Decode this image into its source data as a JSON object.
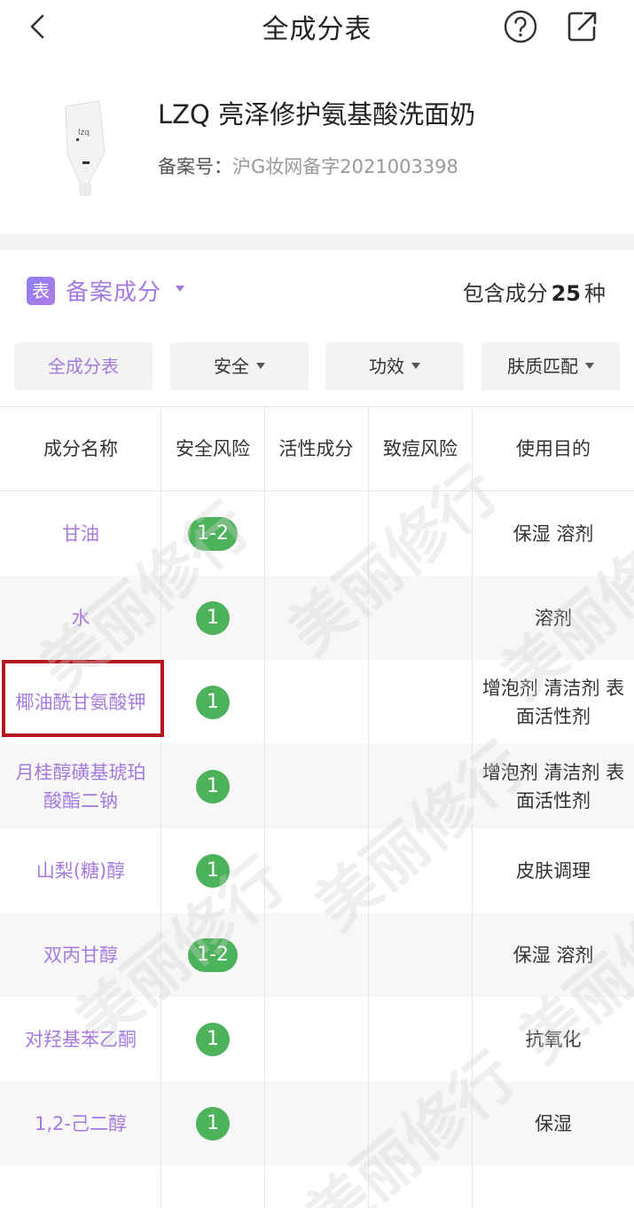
{
  "nav": {
    "title": "全成分表"
  },
  "product": {
    "name": "LZQ 亮泽修护氨基酸洗面奶",
    "reg_label": "备案号：",
    "reg_value": "沪G妆网备字2021003398",
    "tube_label": "lzq"
  },
  "section": {
    "badge": "表",
    "title": "备案成分",
    "count_prefix": "包含成分",
    "count": "25",
    "count_suffix": "种"
  },
  "tabs": [
    {
      "label": "全成分表",
      "active": true
    },
    {
      "label": "安全"
    },
    {
      "label": "功效"
    },
    {
      "label": "肤质匹配"
    }
  ],
  "table": {
    "headers": [
      "成分名称",
      "安全风险",
      "活性成分",
      "致痘风险",
      "使用目的"
    ],
    "rows": [
      {
        "name": "甘油",
        "safety": "1-2",
        "use": "保湿 溶剂"
      },
      {
        "name": "水",
        "safety": "1",
        "use": "溶剂"
      },
      {
        "name": "椰油酰甘氨酸钾",
        "safety": "1",
        "use": "增泡剂 清洁剂 表面活性剂"
      },
      {
        "name": "月桂醇磺基琥珀酸酯二钠",
        "safety": "1",
        "use": "增泡剂 清洁剂 表面活性剂"
      },
      {
        "name": "山梨(糖)醇",
        "safety": "1",
        "use": "皮肤调理"
      },
      {
        "name": "双丙甘醇",
        "safety": "1-2",
        "use": "保湿 溶剂"
      },
      {
        "name": "对羟基苯乙酮",
        "safety": "1",
        "use": "抗氧化"
      },
      {
        "name": "1,2-己二醇",
        "safety": "1",
        "use": "保湿"
      }
    ]
  },
  "watermark_text": "美丽修行",
  "colors": {
    "accent": "#a57ae0",
    "safe_green": "#4cb35a",
    "highlight_red": "#b5151d"
  }
}
